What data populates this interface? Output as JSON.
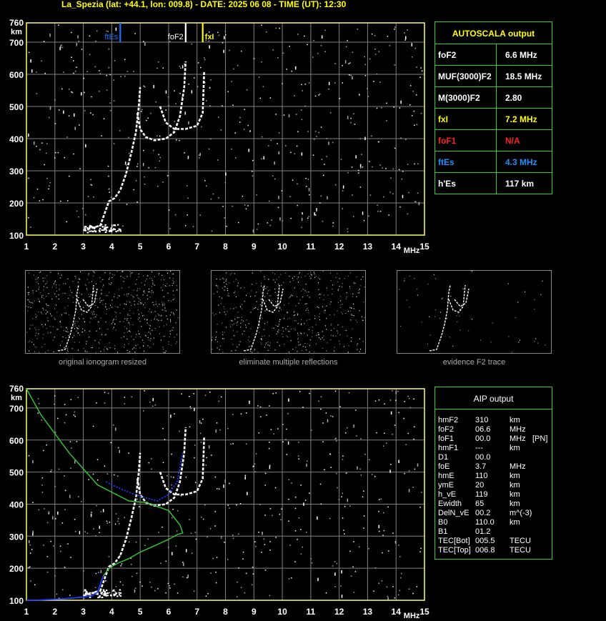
{
  "header": {
    "title": "La_Spezia (lat: +44.1, lon: 009.8) - DATE: 2025 06 08 - TIME (UT): 12:30"
  },
  "colors": {
    "axis": "#ffff66",
    "grid": "#808080",
    "trace": "#ffffff",
    "foEs": "#1e6fff",
    "foF2": "#ffffff",
    "fxI": "#ffff00",
    "profile": "#33cc33",
    "profile_low": "#1e3cff",
    "red": "#ff2020",
    "cyan": "#2090ff"
  },
  "plot_top": {
    "y_unit": "km",
    "x_unit": "MHz",
    "x_ticks": [
      "1",
      "2",
      "3",
      "4",
      "5",
      "6",
      "7",
      "8",
      "9",
      "10",
      "11",
      "12",
      "13",
      "14",
      "15"
    ],
    "y_ticks": [
      "100",
      "200",
      "300",
      "400",
      "500",
      "600",
      "700",
      "760"
    ],
    "markers": [
      {
        "label": "ftEs",
        "freq": 4.3,
        "color": "foEs"
      },
      {
        "label": "foF2",
        "freq": 6.6,
        "color": "foF2"
      },
      {
        "label": "fxI",
        "freq": 7.2,
        "color": "fxI"
      }
    ]
  },
  "autoscala": {
    "title": "AUTOSCALA output",
    "rows": [
      {
        "label": "foF2",
        "value": "6.6 MHz",
        "color": "#ffffff"
      },
      {
        "label": "MUF(3000)F2",
        "value": "18.5 MHz",
        "color": "#ffffff"
      },
      {
        "label": "M(3000)F2",
        "value": "2.80",
        "color": "#ffffff"
      },
      {
        "label": "fxI",
        "value": "7.2 MHz",
        "color": "#ffff00"
      },
      {
        "label": "foF1",
        "value": "N/A",
        "color": "#ff2020"
      },
      {
        "label": "ftEs",
        "value": "4.3 MHz",
        "color": "#2090ff"
      },
      {
        "label": "h'Es",
        "value": "117    km",
        "color": "#ffffff"
      }
    ]
  },
  "thumbnails": [
    {
      "caption": "original ionogram resized",
      "density": 0.9
    },
    {
      "caption": "eliminate multiple reflections",
      "density": 0.7
    },
    {
      "caption": "evidence F2 trace",
      "density": 0.08
    }
  ],
  "aip": {
    "title": "AIP output",
    "rows": [
      {
        "k": "hmF2",
        "v": "310",
        "u": "km",
        "x": ""
      },
      {
        "k": "foF2",
        "v": "06.6",
        "u": "MHz",
        "x": ""
      },
      {
        "k": "foF1",
        "v": "00.0",
        "u": "MHz",
        "x": "[PN]"
      },
      {
        "k": "hmF1",
        "v": "---",
        "u": "km",
        "x": ""
      },
      {
        "k": "D1",
        "v": "00.0",
        "u": "",
        "x": ""
      },
      {
        "k": "foE",
        "v": "3.7",
        "u": "MHz",
        "x": ""
      },
      {
        "k": "hmE",
        "v": "110",
        "u": "km",
        "x": ""
      },
      {
        "k": "ymE",
        "v": "20",
        "u": "km",
        "x": ""
      },
      {
        "k": "h_vE",
        "v": "119",
        "u": "km",
        "x": ""
      },
      {
        "k": "Ewidth",
        "v": "65",
        "u": "km",
        "x": ""
      },
      {
        "k": "DelN_vE",
        "v": "00.2",
        "u": "m^(-3)",
        "x": ""
      },
      {
        "k": "B0",
        "v": "110.0",
        "u": "km",
        "x": ""
      },
      {
        "k": "B1",
        "v": "01.2",
        "u": "",
        "x": ""
      },
      {
        "k": "TEC[Bot]",
        "v": "005.5",
        "u": "TECU",
        "x": ""
      },
      {
        "k": "TEC[Top]",
        "v": "006.8",
        "u": "TECU",
        "x": ""
      }
    ]
  },
  "chart_data": [
    {
      "type": "scatter",
      "title": "",
      "xlabel": "MHz",
      "ylabel": "km",
      "xlim": [
        1,
        15
      ],
      "ylim": [
        100,
        760
      ],
      "grid": true,
      "series": [
        {
          "name": "ftEs",
          "x": [
            4.3,
            4.3
          ],
          "y": [
            700,
            760
          ]
        },
        {
          "name": "foF2",
          "x": [
            6.6,
            6.6
          ],
          "y": [
            700,
            760
          ]
        },
        {
          "name": "fxI",
          "x": [
            7.2,
            7.2
          ],
          "y": [
            700,
            760
          ]
        },
        {
          "name": "",
          "x": [
            3.0,
            3.3,
            3.6,
            3.9,
            4.1,
            4.3,
            4.5,
            4.7,
            4.85,
            4.95,
            5.0
          ],
          "y": [
            115,
            122,
            130,
            205,
            215,
            240,
            290,
            360,
            420,
            500,
            560
          ]
        },
        {
          "name": "",
          "x": [
            4.9,
            5.0,
            5.2,
            5.5,
            5.9,
            6.2,
            6.4,
            6.55,
            6.6
          ],
          "y": [
            480,
            430,
            405,
            395,
            400,
            420,
            470,
            560,
            640
          ]
        },
        {
          "name": "",
          "x": [
            5.7,
            5.9,
            6.2,
            6.6,
            7.0,
            7.2,
            7.25
          ],
          "y": [
            500,
            450,
            430,
            430,
            440,
            480,
            610
          ]
        }
      ]
    },
    {
      "type": "line",
      "title": "",
      "xlabel": "MHz",
      "ylabel": "km",
      "xlim": [
        1,
        15
      ],
      "ylim": [
        100,
        760
      ],
      "grid": true,
      "series": [
        {
          "name": "",
          "x": [
            1.0,
            1.5,
            2.0,
            2.5,
            3.0,
            3.3,
            3.5,
            3.6,
            3.7
          ],
          "y": [
            100,
            101,
            103,
            106,
            110,
            114,
            125,
            150,
            175
          ]
        },
        {
          "name": "",
          "x": [
            3.7,
            3.9,
            4.2,
            4.6,
            5.0,
            5.5,
            6.0,
            6.3,
            6.5,
            6.4,
            6.0,
            5.2,
            4.6,
            3.5,
            2.5,
            1.5,
            1.0
          ],
          "y": [
            175,
            200,
            215,
            230,
            250,
            270,
            290,
            305,
            310,
            335,
            380,
            405,
            410,
            460,
            560,
            680,
            760
          ]
        },
        {
          "name": "",
          "x": [
            3.8,
            4.0,
            4.4,
            4.8,
            5.2,
            5.6,
            6.0,
            6.3,
            6.5
          ],
          "y": [
            470,
            460,
            445,
            430,
            420,
            410,
            430,
            470,
            560
          ]
        }
      ]
    }
  ]
}
